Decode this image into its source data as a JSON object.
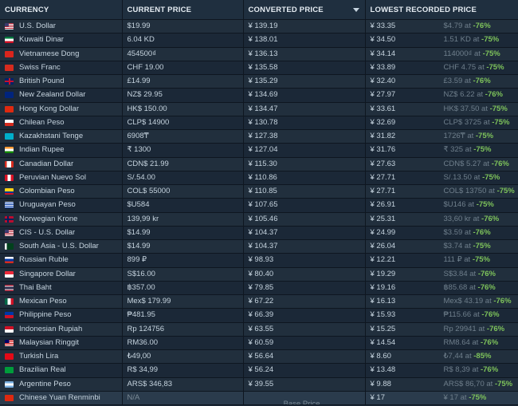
{
  "columns": {
    "currency": "CURRENCY",
    "current_price": "CURRENT PRICE",
    "converted_price": "CONVERTED PRICE",
    "lowest_recorded_price": "LOWEST RECORDED PRICE"
  },
  "rows": [
    {
      "currency": "U.S. Dollar",
      "price": "$19.99",
      "converted": "¥ 139.19",
      "lowest": "¥ 33.35",
      "lowest_local": "$4.79 at ",
      "discount": "-76%",
      "flag": "us-flag"
    },
    {
      "currency": "Kuwaiti Dinar",
      "price": "6.04 KD",
      "converted": "¥ 138.01",
      "lowest": "¥ 34.50",
      "lowest_local": "1.51 KD at ",
      "discount": "-75%",
      "flag": "kw-flag"
    },
    {
      "currency": "Vietnamese Dong",
      "price": "454500₫",
      "converted": "¥ 136.13",
      "lowest": "¥ 34.14",
      "lowest_local": "114000₫ at ",
      "discount": "-75%",
      "flag": "vn-flag"
    },
    {
      "currency": "Swiss Franc",
      "price": "CHF 19.00",
      "converted": "¥ 135.58",
      "lowest": "¥ 33.89",
      "lowest_local": "CHF 4.75 at ",
      "discount": "-75%",
      "flag": "ch-flag"
    },
    {
      "currency": "British Pound",
      "price": "£14.99",
      "converted": "¥ 135.29",
      "lowest": "¥ 32.40",
      "lowest_local": "£3.59 at ",
      "discount": "-76%",
      "flag": "gb-flag"
    },
    {
      "currency": "New Zealand Dollar",
      "price": "NZ$ 29.95",
      "converted": "¥ 134.69",
      "lowest": "¥ 27.97",
      "lowest_local": "NZ$ 6.22 at ",
      "discount": "-76%",
      "flag": "nz-flag"
    },
    {
      "currency": "Hong Kong Dollar",
      "price": "HK$ 150.00",
      "converted": "¥ 134.47",
      "lowest": "¥ 33.61",
      "lowest_local": "HK$ 37.50 at ",
      "discount": "-75%",
      "flag": "hk-flag"
    },
    {
      "currency": "Chilean Peso",
      "price": "CLP$ 14900",
      "converted": "¥ 130.78",
      "lowest": "¥ 32.69",
      "lowest_local": "CLP$ 3725 at ",
      "discount": "-75%",
      "flag": "cl-flag"
    },
    {
      "currency": "Kazakhstani Tenge",
      "price": "6908₸",
      "converted": "¥ 127.38",
      "lowest": "¥ 31.82",
      "lowest_local": "1726₸ at ",
      "discount": "-75%",
      "flag": "kz-flag"
    },
    {
      "currency": "Indian Rupee",
      "price": "₹ 1300",
      "converted": "¥ 127.04",
      "lowest": "¥ 31.76",
      "lowest_local": "₹ 325 at ",
      "discount": "-75%",
      "flag": "in-flag"
    },
    {
      "currency": "Canadian Dollar",
      "price": "CDN$ 21.99",
      "converted": "¥ 115.30",
      "lowest": "¥ 27.63",
      "lowest_local": "CDN$ 5.27 at ",
      "discount": "-76%",
      "flag": "ca-flag"
    },
    {
      "currency": "Peruvian Nuevo Sol",
      "price": "S/.54.00",
      "converted": "¥ 110.86",
      "lowest": "¥ 27.71",
      "lowest_local": "S/.13.50 at ",
      "discount": "-75%",
      "flag": "pe-flag"
    },
    {
      "currency": "Colombian Peso",
      "price": "COL$ 55000",
      "converted": "¥ 110.85",
      "lowest": "¥ 27.71",
      "lowest_local": "COL$ 13750 at ",
      "discount": "-75%",
      "flag": "co-flag"
    },
    {
      "currency": "Uruguayan Peso",
      "price": "$U584",
      "converted": "¥ 107.65",
      "lowest": "¥ 26.91",
      "lowest_local": "$U146 at ",
      "discount": "-75%",
      "flag": "uy-flag"
    },
    {
      "currency": "Norwegian Krone",
      "price": "139,99 kr",
      "converted": "¥ 105.46",
      "lowest": "¥ 25.31",
      "lowest_local": "33,60 kr at ",
      "discount": "-76%",
      "flag": "no-flag"
    },
    {
      "currency": "CIS - U.S. Dollar",
      "price": "$14.99",
      "converted": "¥ 104.37",
      "lowest": "¥ 24.99",
      "lowest_local": "$3.59 at ",
      "discount": "-76%",
      "flag": "cis-flag"
    },
    {
      "currency": "South Asia - U.S. Dollar",
      "price": "$14.99",
      "converted": "¥ 104.37",
      "lowest": "¥ 26.04",
      "lowest_local": "$3.74 at ",
      "discount": "-75%",
      "flag": "pk-flag"
    },
    {
      "currency": "Russian Ruble",
      "price": "899 ₽",
      "converted": "¥ 98.93",
      "lowest": "¥ 12.21",
      "lowest_local": "111 ₽ at ",
      "discount": "-75%",
      "flag": "ru-flag"
    },
    {
      "currency": "Singapore Dollar",
      "price": "S$16.00",
      "converted": "¥ 80.40",
      "lowest": "¥ 19.29",
      "lowest_local": "S$3.84 at ",
      "discount": "-76%",
      "flag": "sg-flag"
    },
    {
      "currency": "Thai Baht",
      "price": "฿357.00",
      "converted": "¥ 79.85",
      "lowest": "¥ 19.16",
      "lowest_local": "฿85.68 at ",
      "discount": "-76%",
      "flag": "th-flag"
    },
    {
      "currency": "Mexican Peso",
      "price": "Mex$ 179.99",
      "converted": "¥ 67.22",
      "lowest": "¥ 16.13",
      "lowest_local": "Mex$ 43.19 at ",
      "discount": "-76%",
      "flag": "mx-flag"
    },
    {
      "currency": "Philippine Peso",
      "price": "₱481.95",
      "converted": "¥ 66.39",
      "lowest": "¥ 15.93",
      "lowest_local": "₱115.66 at ",
      "discount": "-76%",
      "flag": "ph-flag"
    },
    {
      "currency": "Indonesian Rupiah",
      "price": "Rp 124756",
      "converted": "¥ 63.55",
      "lowest": "¥ 15.25",
      "lowest_local": "Rp 29941 at ",
      "discount": "-76%",
      "flag": "id-flag"
    },
    {
      "currency": "Malaysian Ringgit",
      "price": "RM36.00",
      "converted": "¥ 60.59",
      "lowest": "¥ 14.54",
      "lowest_local": "RM8.64 at ",
      "discount": "-76%",
      "flag": "my-flag"
    },
    {
      "currency": "Turkish Lira",
      "price": "₺49,00",
      "converted": "¥ 56.64",
      "lowest": "¥ 8.60",
      "lowest_local": "₺7,44 at ",
      "discount": "-85%",
      "flag": "tr-flag"
    },
    {
      "currency": "Brazilian Real",
      "price": "R$ 34,99",
      "converted": "¥ 56.24",
      "lowest": "¥ 13.48",
      "lowest_local": "R$ 8,39 at ",
      "discount": "-76%",
      "flag": "br-flag"
    },
    {
      "currency": "Argentine Peso",
      "price": "ARS$ 346,83",
      "converted": "¥ 39.55",
      "lowest": "¥ 9.88",
      "lowest_local": "ARS$ 86,70 at ",
      "discount": "-75%",
      "flag": "ar-flag"
    },
    {
      "currency": "Chinese Yuan Renminbi",
      "price": "N/A",
      "converted": "",
      "base_label": "Base Price",
      "lowest": "¥ 17",
      "lowest_local": "¥ 17 at ",
      "discount": "-75%",
      "flag": "cn-flag",
      "base": true
    }
  ],
  "colors": {
    "background": "#1b2838",
    "discount": "#7ec35b",
    "muted": "#6f7f8c"
  }
}
